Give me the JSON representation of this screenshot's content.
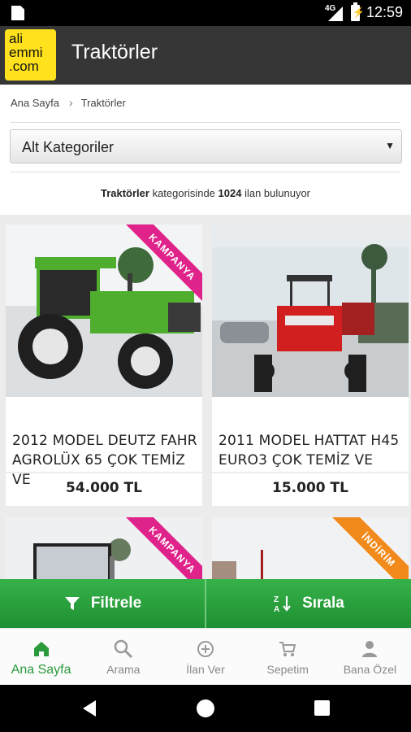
{
  "status_bar": {
    "network": "4G",
    "time": "12:59"
  },
  "app_bar": {
    "logo_lines": [
      "ali",
      "emmi",
      ".com"
    ],
    "title": "Traktörler"
  },
  "breadcrumb": {
    "home": "Ana Sayfa",
    "current": "Traktörler"
  },
  "subcategory_select": {
    "label": "Alt Kategoriler"
  },
  "listing_count": {
    "category": "Traktörler",
    "middle": " kategorisinde ",
    "count": "1024",
    "suffix": " ilan bulunuyor"
  },
  "listings": [
    {
      "title": "2012 MODEL DEUTZ FAHR AGROLÜX 65 ÇOK TEMİZ VE",
      "price": "54.000 TL",
      "badge": "KAMPANYA",
      "badge_color": "#e0238a"
    },
    {
      "title": "2011 MODEL HATTAT H45 EURO3 ÇOK TEMİZ VE",
      "price": "15.000 TL",
      "badge": "",
      "badge_color": ""
    },
    {
      "title": "",
      "price": "",
      "badge": "KAMPANYA",
      "badge_color": "#e0238a"
    },
    {
      "title": "",
      "price": "",
      "badge": "İNDİRİM",
      "badge_color": "#f28a1b"
    }
  ],
  "actions": {
    "filter": "Filtrele",
    "sort": "Sırala"
  },
  "bottom_nav": {
    "items": [
      {
        "label": "Ana Sayfa",
        "icon": "home-icon",
        "active": true
      },
      {
        "label": "Arama",
        "icon": "search-icon",
        "active": false
      },
      {
        "label": "İlan Ver",
        "icon": "add-circle-icon",
        "active": false
      },
      {
        "label": "Sepetim",
        "icon": "cart-icon",
        "active": false
      },
      {
        "label": "Bana Özel",
        "icon": "person-icon",
        "active": false
      }
    ]
  },
  "colors": {
    "accent": "#2b9a3b",
    "app_bar": "#363636",
    "logo": "#ffe21d"
  }
}
